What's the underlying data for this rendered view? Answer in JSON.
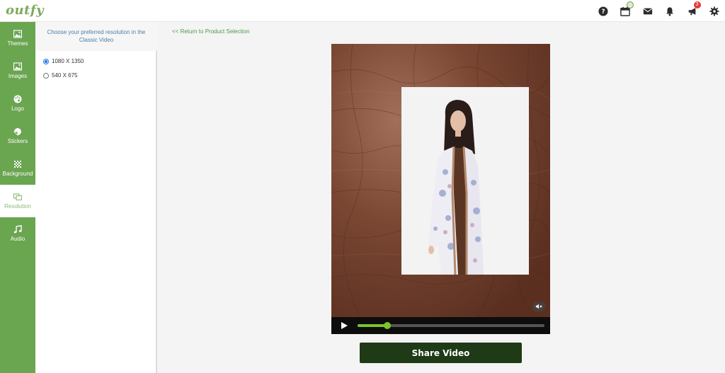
{
  "brand": {
    "logo_text": "outfy"
  },
  "header": {
    "icons": [
      {
        "name": "help-icon"
      },
      {
        "name": "calendar-icon",
        "badge": ""
      },
      {
        "name": "mail-icon"
      },
      {
        "name": "bell-icon"
      },
      {
        "name": "megaphone-icon",
        "badge": "3"
      },
      {
        "name": "gear-icon"
      }
    ]
  },
  "sidebar": {
    "items": [
      {
        "label": "Themes",
        "icon": "image-icon"
      },
      {
        "label": "Images",
        "icon": "image-icon"
      },
      {
        "label": "Logo",
        "icon": "palette-icon"
      },
      {
        "label": "Stickers",
        "icon": "sticker-icon"
      },
      {
        "label": "Background",
        "icon": "pattern-icon"
      },
      {
        "label": "Resolution",
        "icon": "resolution-icon",
        "active": true
      },
      {
        "label": "Audio",
        "icon": "music-note-icon"
      }
    ]
  },
  "panel": {
    "title": "Choose your preferred resolution in the Classic Video",
    "options": [
      {
        "label": "1080 X 1350",
        "selected": true
      },
      {
        "label": "540 X 675",
        "selected": false
      }
    ]
  },
  "main": {
    "return_link": "<< Return to Product Selection",
    "video": {
      "progress": 0.16,
      "muted": true
    },
    "share_button": "Share Video"
  },
  "colors": {
    "sidebar": "#6aa550",
    "share_button": "#1e3a16",
    "progress": "#7dc52a",
    "link": "#4a9a4a"
  }
}
